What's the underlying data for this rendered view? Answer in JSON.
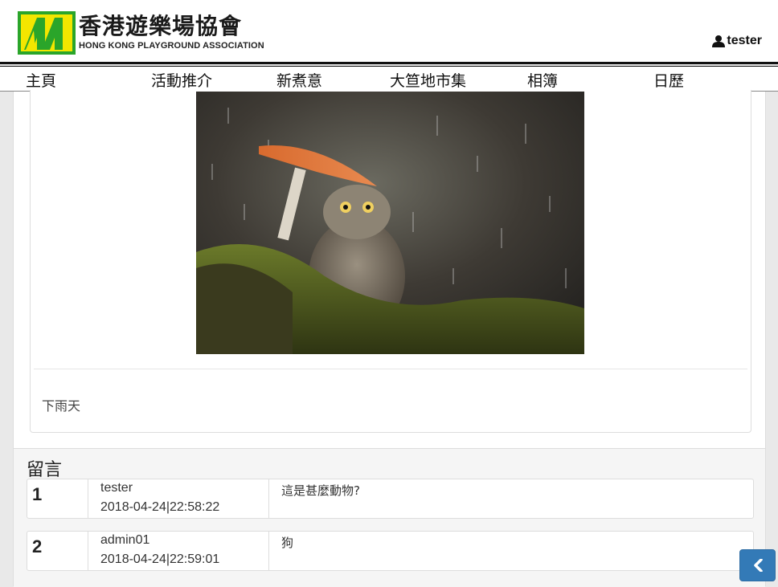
{
  "header": {
    "logo_chinese": "香港遊樂場協會",
    "logo_english": "HONG KONG PLAYGROUND ASSOCIATION",
    "username": "tester"
  },
  "nav": {
    "items": [
      {
        "label": "主頁"
      },
      {
        "label": "活動推介"
      },
      {
        "label": "新煮意"
      },
      {
        "label": "大笪地市集"
      },
      {
        "label": "相簿"
      },
      {
        "label": "日歷"
      }
    ]
  },
  "post": {
    "image_alt": "owl under mushroom in rain",
    "caption": "下雨天"
  },
  "comments": {
    "title": "留言",
    "items": [
      {
        "number": "1",
        "user": "tester",
        "time": "2018-04-24|22:58:22",
        "text": "這是甚麼動物?"
      },
      {
        "number": "2",
        "user": "admin01",
        "time": "2018-04-24|22:59:01",
        "text": "狗"
      }
    ]
  },
  "colors": {
    "accent": "#337ab7",
    "logo_green": "#2aa52a",
    "logo_yellow": "#f3e600"
  },
  "icons": {
    "user": "user-icon",
    "back": "chevron-left-icon"
  }
}
